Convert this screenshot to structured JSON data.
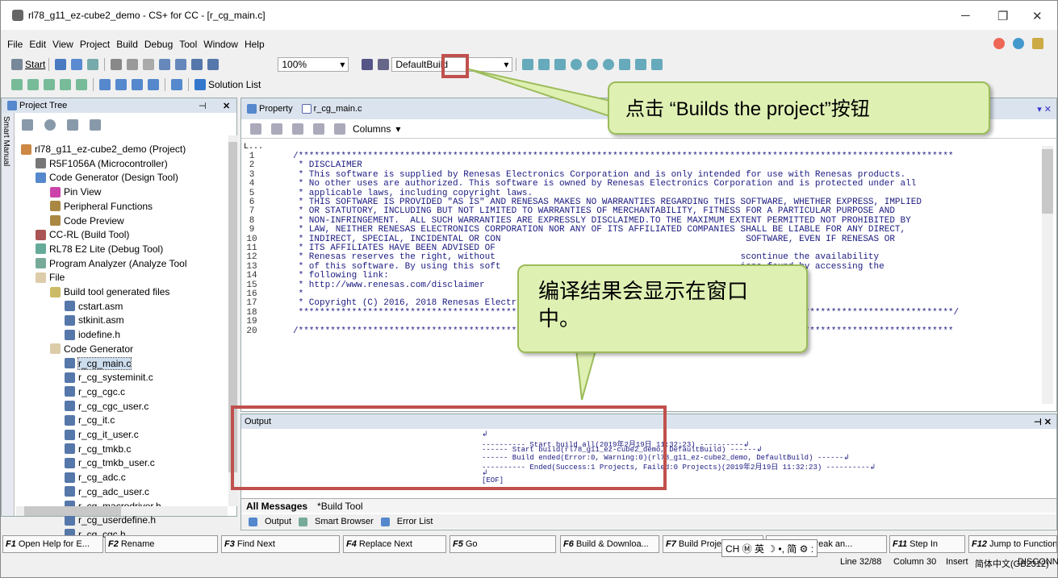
{
  "window": {
    "title": "rl78_g11_ez-cube2_demo - CS+ for CC - [r_cg_main.c]"
  },
  "menu": [
    "File",
    "Edit",
    "View",
    "Project",
    "Build",
    "Debug",
    "Tool",
    "Window",
    "Help"
  ],
  "toolbar": {
    "start": "Start",
    "zoom": "100%",
    "build_mode": "DefaultBuild",
    "solution_list": "Solution List"
  },
  "project_tree": {
    "title": "Project Tree",
    "tab_label": "Smart Manual",
    "items": [
      {
        "label": "rl78_g11_ez-cube2_demo (Project)",
        "depth": 0
      },
      {
        "label": "R5F1056A (Microcontroller)",
        "depth": 1
      },
      {
        "label": "Code Generator (Design Tool)",
        "depth": 1
      },
      {
        "label": "Pin View",
        "depth": 2
      },
      {
        "label": "Peripheral Functions",
        "depth": 2
      },
      {
        "label": "Code Preview",
        "depth": 2
      },
      {
        "label": "CC-RL (Build Tool)",
        "depth": 1
      },
      {
        "label": "RL78 E2 Lite (Debug Tool)",
        "depth": 1
      },
      {
        "label": "Program Analyzer (Analyze Tool",
        "depth": 1
      },
      {
        "label": "File",
        "depth": 1
      },
      {
        "label": "Build tool generated files",
        "depth": 2
      },
      {
        "label": "cstart.asm",
        "depth": 3
      },
      {
        "label": "stkinit.asm",
        "depth": 3
      },
      {
        "label": "iodefine.h",
        "depth": 3
      },
      {
        "label": "Code Generator",
        "depth": 2
      },
      {
        "label": "r_cg_main.c",
        "depth": 3
      },
      {
        "label": "r_cg_systeminit.c",
        "depth": 3
      },
      {
        "label": "r_cg_cgc.c",
        "depth": 3
      },
      {
        "label": "r_cg_cgc_user.c",
        "depth": 3
      },
      {
        "label": "r_cg_it.c",
        "depth": 3
      },
      {
        "label": "r_cg_it_user.c",
        "depth": 3
      },
      {
        "label": "r_cg_tmkb.c",
        "depth": 3
      },
      {
        "label": "r_cg_tmkb_user.c",
        "depth": 3
      },
      {
        "label": "r_cg_adc.c",
        "depth": 3
      },
      {
        "label": "r_cg_adc_user.c",
        "depth": 3
      },
      {
        "label": "r_cg_macrodriver.h",
        "depth": 3
      },
      {
        "label": "r_cg_userdefine.h",
        "depth": 3
      },
      {
        "label": "r_cg_cgc.h",
        "depth": 3
      }
    ]
  },
  "editor": {
    "tabs": [
      "Property",
      "r_cg_main.c"
    ],
    "columns_label": "Columns",
    "gutter_label": "L...",
    "lines": [
      {
        "n": "1",
        "t": "/***************************************************************************************************************************"
      },
      {
        "n": "2",
        "t": " * DISCLAIMER"
      },
      {
        "n": "3",
        "t": " * This software is supplied by Renesas Electronics Corporation and is only intended for use with Renesas products."
      },
      {
        "n": "4",
        "t": " * No other uses are authorized. This software is owned by Renesas Electronics Corporation and is protected under all"
      },
      {
        "n": "5",
        "t": " * applicable laws, including copyright laws."
      },
      {
        "n": "6",
        "t": " * THIS SOFTWARE IS PROVIDED \"AS IS\" AND RENESAS MAKES NO WARRANTIES REGARDING THIS SOFTWARE, WHETHER EXPRESS, IMPLIED"
      },
      {
        "n": "7",
        "t": " * OR STATUTORY, INCLUDING BUT NOT LIMITED TO WARRANTIES OF MERCHANTABILITY, FITNESS FOR A PARTICULAR PURPOSE AND"
      },
      {
        "n": "8",
        "t": " * NON-INFRINGEMENT.  ALL SUCH WARRANTIES ARE EXPRESSLY DISCLAIMED.TO THE MAXIMUM EXTENT PERMITTED NOT PROHIBITED BY"
      },
      {
        "n": "9",
        "t": " * LAW, NEITHER RENESAS ELECTRONICS CORPORATION NOR ANY OF ITS AFFILIATED COMPANIES SHALL BE LIABLE FOR ANY DIRECT,"
      },
      {
        "n": "10",
        "t": " * INDIRECT, SPECIAL, INCIDENTAL OR CON                                              SOFTWARE, EVEN IF RENESAS OR"
      },
      {
        "n": "11",
        "t": " * ITS AFFILIATES HAVE BEEN ADVISED OF"
      },
      {
        "n": "12",
        "t": " * Renesas reserves the right, without                                              scontinue the availability"
      },
      {
        "n": "13",
        "t": " * of this software. By using this soft                                             ions found by accessing the"
      },
      {
        "n": "14",
        "t": " * following link:"
      },
      {
        "n": "15",
        "t": " * http://www.renesas.com/disclaimer"
      },
      {
        "n": "16",
        "t": " *"
      },
      {
        "n": "17",
        "t": " * Copyright (C) 2016, 2018 Renesas Electronics            on. All rights reserved."
      },
      {
        "n": "18",
        "t": " ***************************************************************************************************************************/"
      },
      {
        "n": "19",
        "t": ""
      },
      {
        "n": "20",
        "t": "/***************************************************************************************************************************"
      }
    ]
  },
  "output": {
    "title": "Output",
    "lines": [
      "↲",
      "---------- Start build all(2019年2月19日 11:32:23) ----------↲",
      "------ Start build(rl78_g11_ez-cube2_demo, DefaultBuild) ------↲",
      "------ Build ended(Error:0, Warning:0)(rl78_g11_ez-cube2_demo, DefaultBuild) ------↲",
      "---------- Ended(Success:1 Projects, Failed:0 Projects)(2019年2月19日 11:32:23) ----------↲",
      "↲",
      "[EOF]"
    ],
    "tabs": [
      "All Messages",
      "*Build Tool"
    ],
    "bottom_tabs": [
      "Output",
      "Smart Browser",
      "Error List"
    ]
  },
  "fkeys": [
    {
      "k": "F1",
      "l": "Open Help for E..."
    },
    {
      "k": "F2",
      "l": "Rename"
    },
    {
      "k": "F3",
      "l": "Find Next"
    },
    {
      "k": "F4",
      "l": "Replace Next"
    },
    {
      "k": "F5",
      "l": "Go"
    },
    {
      "k": "F6",
      "l": "Build & Downloa..."
    },
    {
      "k": "F7",
      "l": "Build Project"
    },
    {
      "k": "F8",
      "l": "Ignore Break an..."
    },
    {
      "k": "F11",
      "l": "Step In"
    },
    {
      "k": "F12",
      "l": "Jump to Function"
    }
  ],
  "ime": {
    "text": "CH Ⓜ 英 ☽ •, 简 ⚙ :"
  },
  "status": {
    "line": "Line 32/88",
    "column": "Column 30",
    "mode": "Insert",
    "encoding": "简体中文(GB2312)",
    "connection": "DISCONNECT"
  },
  "callouts": {
    "build_hint": "点击 “Builds the project”按钮",
    "output_hint": "编译结果会显示在窗口中。"
  },
  "colors": {
    "callout_fill": "#dff0b3",
    "highlight": "#c0504d"
  }
}
